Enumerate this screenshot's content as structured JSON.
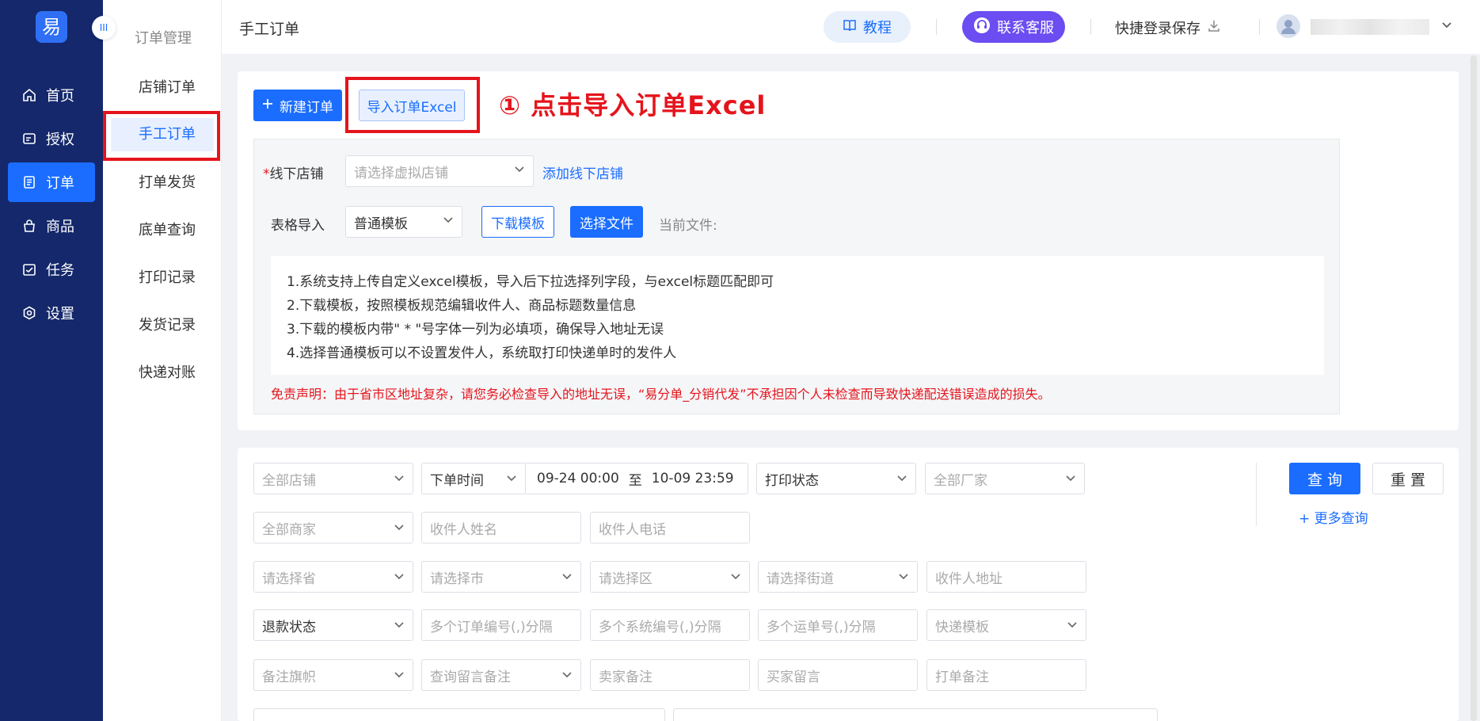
{
  "sidebar": {
    "logo": "易",
    "items": [
      {
        "label": "首页",
        "icon": "home-icon"
      },
      {
        "label": "授权",
        "icon": "authorize-icon"
      },
      {
        "label": "订单",
        "icon": "order-icon",
        "active": true
      },
      {
        "label": "商品",
        "icon": "goods-icon"
      },
      {
        "label": "任务",
        "icon": "task-icon"
      },
      {
        "label": "设置",
        "icon": "settings-icon"
      }
    ],
    "collapse_icon": "III"
  },
  "submenu": {
    "title": "订单管理",
    "items": [
      {
        "label": "店铺订单"
      },
      {
        "label": "手工订单",
        "active": true
      },
      {
        "label": "打单发货"
      },
      {
        "label": "底单查询"
      },
      {
        "label": "打印记录"
      },
      {
        "label": "发货记录"
      },
      {
        "label": "快递对账"
      }
    ]
  },
  "header": {
    "title": "手工订单",
    "tutorial": "教程",
    "service": "联系客服",
    "quick_save": "快捷登录保存"
  },
  "import_card": {
    "new_order": "新建订单",
    "import_excel": "导入订单Excel",
    "annotation": "① 点击导入订单Excel",
    "offline_store_label": "线下店铺",
    "offline_store_placeholder": "请选择虚拟店铺",
    "add_offline_store": "添加线下店铺",
    "table_import_label": "表格导入",
    "template_value": "普通模板",
    "download_template": "下载模板",
    "choose_file": "选择文件",
    "current_file": "当前文件:",
    "notes": [
      "1.系统支持上传自定义excel模板，导入后下拉选择列字段，与excel标题匹配即可",
      "2.下载模板，按照模板规范编辑收件人、商品标题数量信息",
      "3.下载的模板内带\" * \"号字体一列为必填项，确保导入地址无误",
      "4.选择普通模板可以不设置发件人，系统取打印快递单时的发件人"
    ],
    "disclaimer": "免责声明：由于省市区地址复杂，请您务必检查导入的地址无误，“易分单_分销代发”不承担因个人未检查而导致快递配送错误造成的损失。"
  },
  "filters": {
    "all_stores": "全部店铺",
    "order_time": "下单时间",
    "date_start": "09-24 00:00",
    "date_to": "至",
    "date_end": "10-09 23:59",
    "print_status": "打印状态",
    "all_factories": "全部厂家",
    "all_merchants": "全部商家",
    "receiver_name": "收件人姓名",
    "receiver_phone": "收件人电话",
    "province": "请选择省",
    "city": "请选择市",
    "district": "请选择区",
    "street": "请选择街道",
    "receiver_address": "收件人地址",
    "refund_status": "退款状态",
    "multi_order_no": "多个订单编号(,)分隔",
    "multi_system_no": "多个系统编号(,)分隔",
    "multi_waybill_no": "多个运单号(,)分隔",
    "express_template": "快递模板",
    "remark_flag": "备注旗帜",
    "query_message": "查询留言备注",
    "seller_remark": "卖家备注",
    "buyer_message": "买家留言",
    "print_remark": "打单备注",
    "query": "查 询",
    "reset": "重 置",
    "more_query": "+ 更多查询"
  }
}
